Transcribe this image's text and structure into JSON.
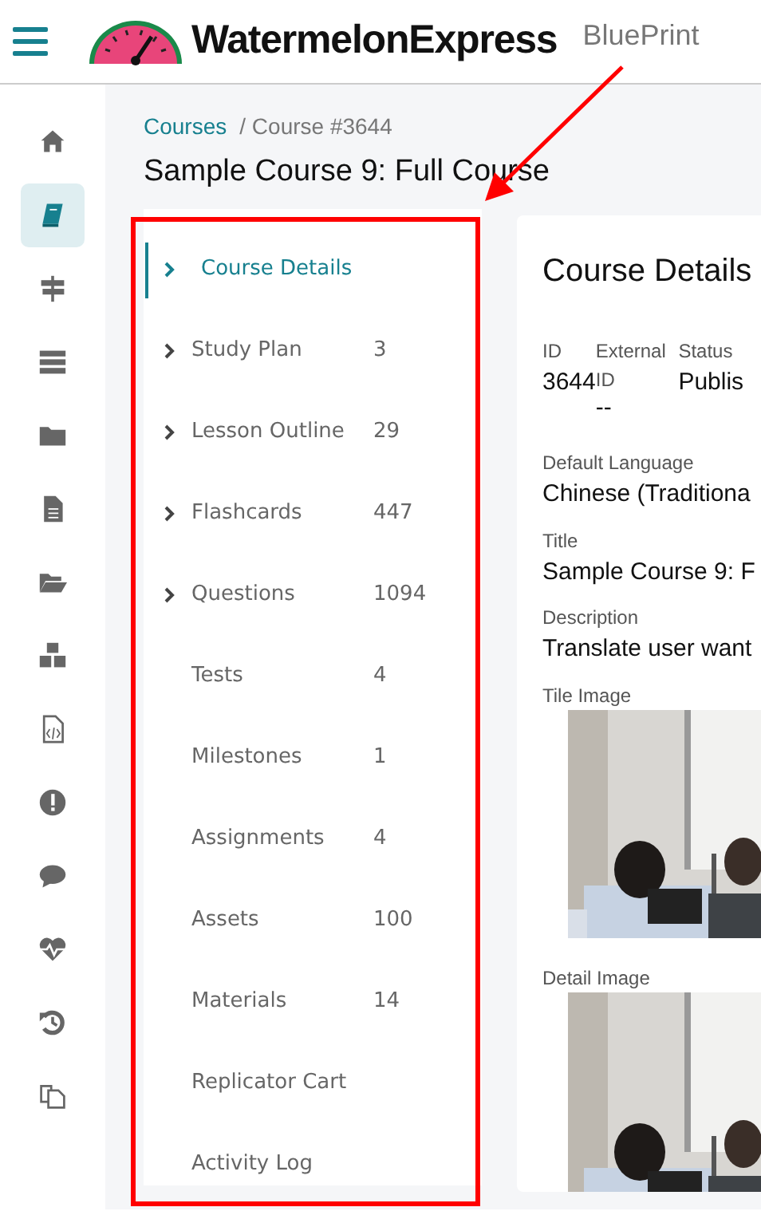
{
  "header": {
    "brand": "WatermelonExpress",
    "product": "BluePrint"
  },
  "rail_items": [
    {
      "selected": false
    },
    {
      "selected": true
    },
    {
      "selected": false
    },
    {
      "selected": false
    },
    {
      "selected": false
    },
    {
      "selected": false
    },
    {
      "selected": false
    },
    {
      "selected": false
    },
    {
      "selected": false
    },
    {
      "selected": false
    },
    {
      "selected": false
    },
    {
      "selected": false
    },
    {
      "selected": false
    },
    {
      "selected": false
    }
  ],
  "breadcrumb": {
    "link": "Courses",
    "current": "/ Course #3644"
  },
  "page_title": "Sample Course 9: Full Course",
  "nav": [
    {
      "label": "Course Details",
      "expandable": true,
      "selected": true
    },
    {
      "label": "Study Plan",
      "count": "3",
      "expandable": true,
      "selected": false
    },
    {
      "label": "Lesson Outline",
      "count": "29",
      "expandable": true,
      "selected": false
    },
    {
      "label": "Flashcards",
      "count": "447",
      "expandable": true,
      "selected": false
    },
    {
      "label": "Questions",
      "count": "1094",
      "expandable": true,
      "selected": false
    },
    {
      "label": "Tests",
      "count": "4",
      "expandable": false,
      "selected": false
    },
    {
      "label": "Milestones",
      "count": "1",
      "expandable": false,
      "selected": false
    },
    {
      "label": "Assignments",
      "count": "4",
      "expandable": false,
      "selected": false
    },
    {
      "label": "Assets",
      "count": "100",
      "expandable": false,
      "selected": false
    },
    {
      "label": "Materials",
      "count": "14",
      "expandable": false,
      "selected": false
    },
    {
      "label": "Replicator Cart",
      "expandable": false,
      "selected": false
    },
    {
      "label": "Activity Log",
      "expandable": false,
      "selected": false
    }
  ],
  "details": {
    "title": "Course Details",
    "columns": [
      {
        "label": "ID",
        "value": "3644"
      },
      {
        "label": "External ID",
        "value": "--"
      },
      {
        "label": "Status",
        "value": "Publis"
      }
    ],
    "fields": [
      {
        "label": "Default Language",
        "value": "Chinese (Traditiona"
      },
      {
        "label": "Title",
        "value": "Sample Course 9: F"
      },
      {
        "label": "Description",
        "value": "Translate user want"
      }
    ],
    "images": [
      {
        "label": "Tile Image",
        "kind": "picture"
      },
      {
        "label": "Detail Image",
        "kind": "picture"
      }
    ]
  }
}
